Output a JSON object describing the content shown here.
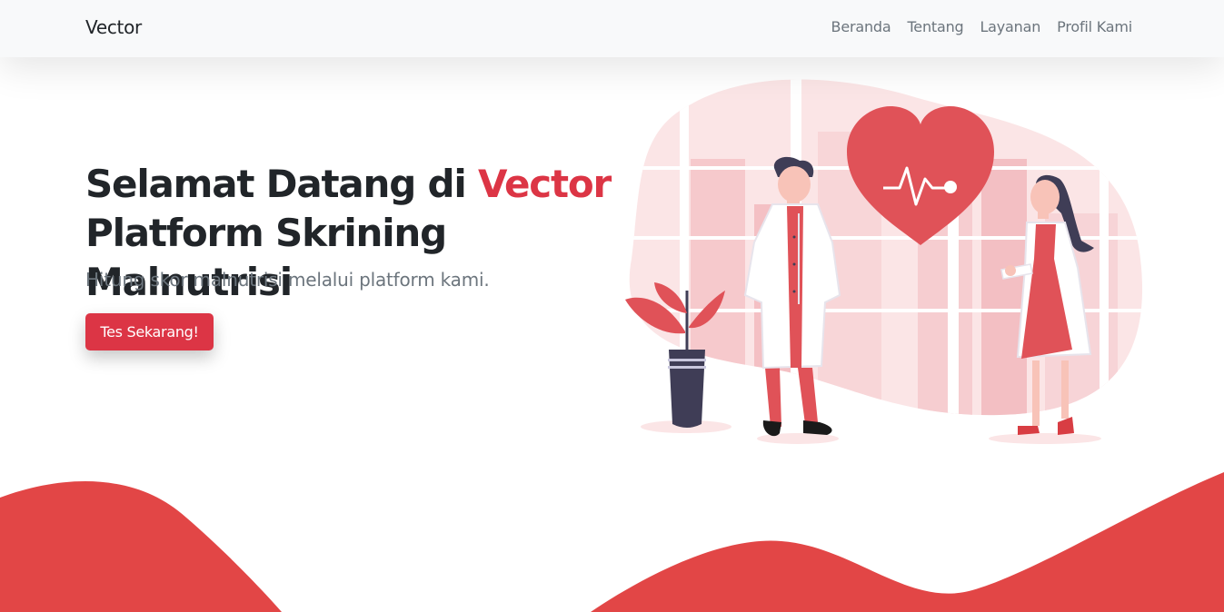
{
  "navbar": {
    "brand": "Vector",
    "links": [
      "Beranda",
      "Tentang",
      "Layanan",
      "Profil Kami"
    ]
  },
  "hero": {
    "title_part1": "Selamat Datang di ",
    "title_accent": "Vector",
    "title_line2": "Platform Skrining Malnutrisi",
    "subtitle": "Hitung skor malnutrisi melalui platform kami.",
    "cta_label": "Tes Sekarang!"
  },
  "illustration": {
    "icons": [
      "heart-pulse-icon",
      "doctor-male",
      "doctor-female",
      "potted-plant"
    ]
  },
  "colors": {
    "accent": "#dc3545",
    "wave": "#e24646",
    "navbar_bg": "#f8f9fa",
    "muted_text": "#6c757d"
  }
}
